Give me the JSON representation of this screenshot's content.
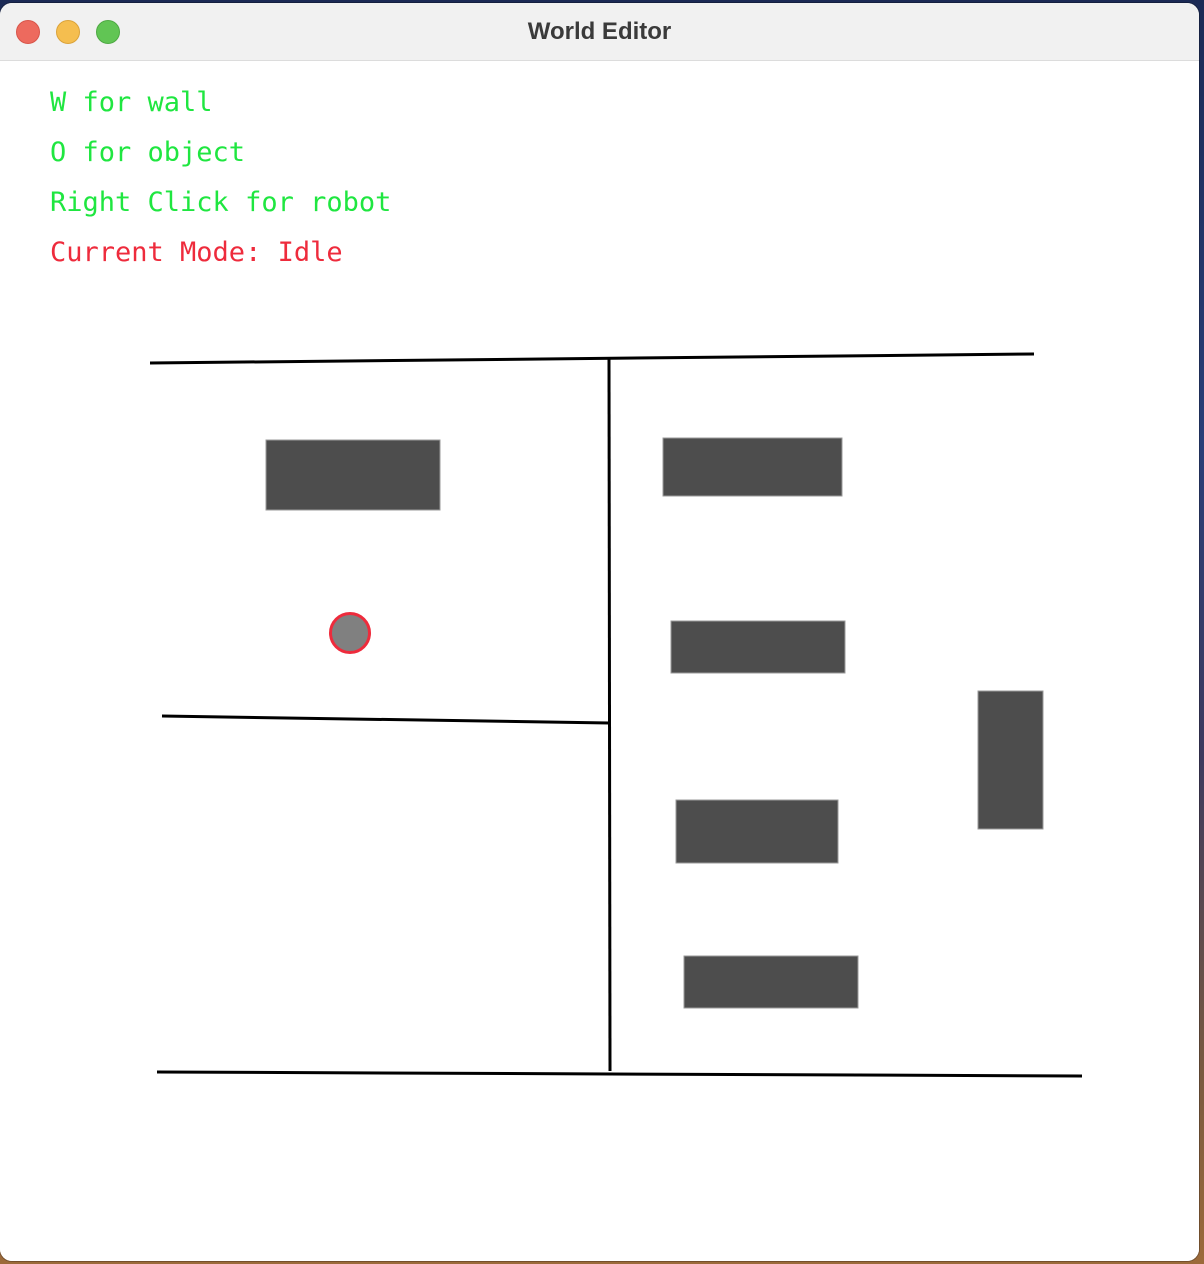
{
  "window": {
    "title": "World Editor"
  },
  "help": {
    "line1": "W for wall",
    "line2": "O for object",
    "line3": "Right Click for robot",
    "mode": "Current Mode: Idle"
  },
  "colors": {
    "help_text": "#1fe640",
    "mode_text": "#ee2b3c",
    "wall": "#000000",
    "object": "#4d4d4d",
    "robot_fill": "#808080",
    "robot_outline": "#ee2b3c"
  }
}
